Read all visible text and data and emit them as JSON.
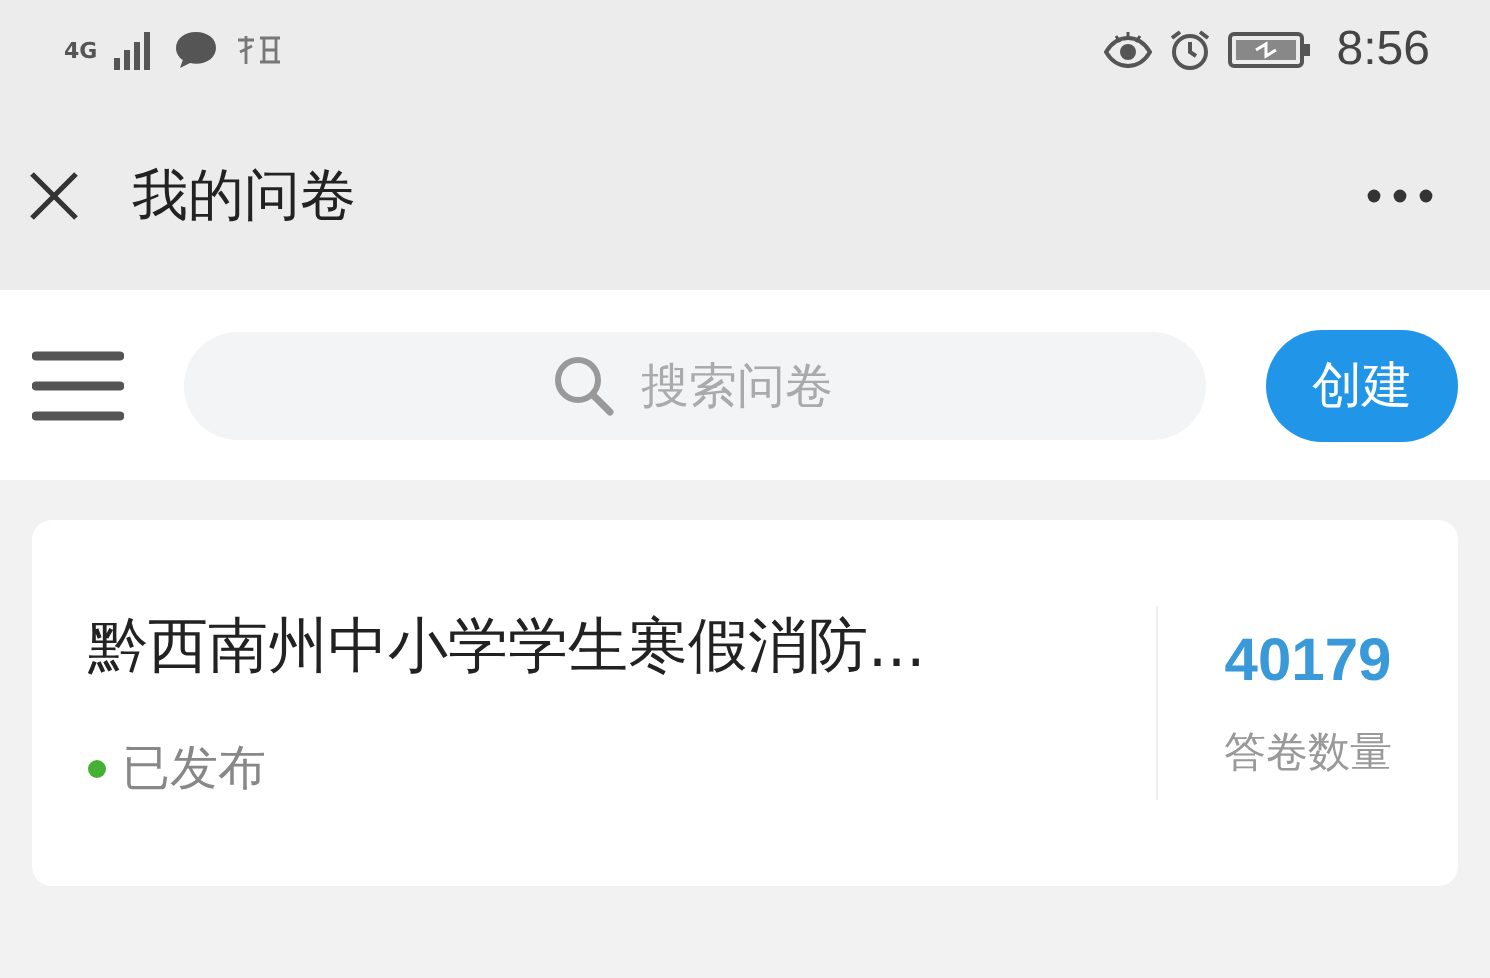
{
  "status_bar": {
    "network": "4G",
    "time": "8:56"
  },
  "title_bar": {
    "title": "我的问卷"
  },
  "search": {
    "placeholder": "搜索问卷",
    "create_button": "创建"
  },
  "surveys": [
    {
      "title": "黔西南州中小学学生寒假消防...",
      "status": "已发布",
      "published": true,
      "count": "40179",
      "count_label": "答卷数量"
    }
  ]
}
